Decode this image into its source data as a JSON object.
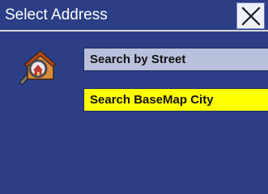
{
  "window": {
    "title": "Select Address",
    "background_color": "#2b3e86"
  },
  "header": {
    "close_icon": "close-x-icon"
  },
  "icon": {
    "name": "house-magnifier-icon"
  },
  "options": [
    {
      "label": "Search by Street",
      "state": "normal",
      "color": "#b9c0dc"
    },
    {
      "label": "Search BaseMap City",
      "state": "highlighted",
      "color": "#ffff00"
    }
  ]
}
